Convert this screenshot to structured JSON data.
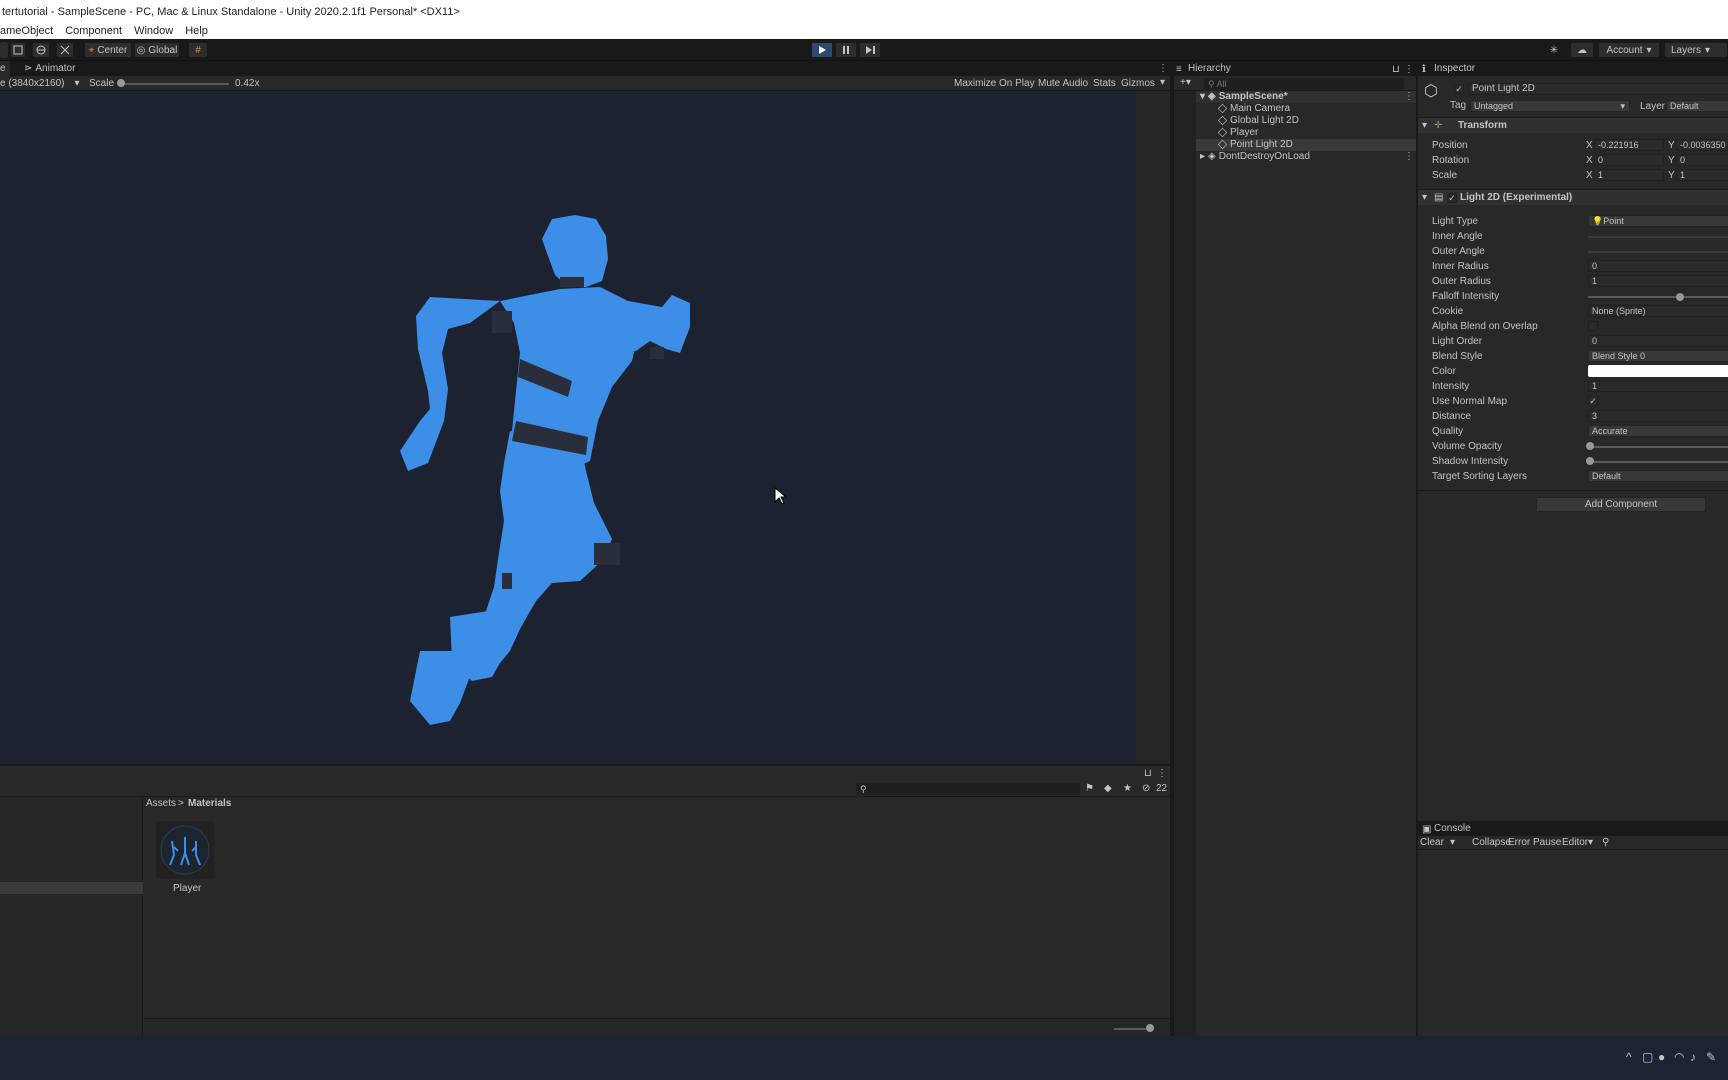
{
  "window": {
    "title": "tertutorial - SampleScene - PC, Mac & Linux Standalone - Unity 2020.2.1f1 Personal* <DX11>"
  },
  "menu": {
    "items": [
      "ameObject",
      "Component",
      "Window",
      "Help"
    ]
  },
  "toolbar": {
    "center_label": "Center",
    "global_label": "Global",
    "play_icon": "play-icon",
    "pause_icon": "pause-icon",
    "step_icon": "step-icon",
    "account_label": "Account",
    "layers_label": "Layers"
  },
  "game": {
    "tab_partial": "e",
    "animator_tab": "Animator",
    "resolution": "e (3840x2160)",
    "scale_label": "Scale",
    "scale_value": "0.42x",
    "scale_level": 0.0,
    "maximize_label": "Maximize On Play",
    "mute_label": "Mute Audio",
    "stats_label": "Stats",
    "gizmos_label": "Gizmos"
  },
  "hierarchy": {
    "title": "Hierarchy",
    "search_placeholder": "All",
    "scene": "SampleScene*",
    "items": [
      "Main Camera",
      "Global Light 2D",
      "Player",
      "Point Light 2D"
    ],
    "dontdestroy": "DontDestroyOnLoad"
  },
  "inspector": {
    "title": "Inspector",
    "object_name": "Point Light 2D",
    "tag_label": "Tag",
    "tag_value": "Untagged",
    "layer_label": "Layer",
    "layer_value": "Default",
    "transform": {
      "title": "Transform",
      "position_label": "Position",
      "position_x": "-0.221916",
      "position_y": "-0.0036350",
      "rotation_label": "Rotation",
      "rotation_x": "0",
      "rotation_y": "0",
      "scale_label": "Scale",
      "scale_x": "1",
      "scale_y": "1",
      "x": "X",
      "y": "Y"
    },
    "light": {
      "title": "Light 2D (Experimental)",
      "rows": {
        "light_type": "Light Type",
        "inner_angle": "Inner Angle",
        "outer_angle": "Outer Angle",
        "inner_radius": "Inner Radius",
        "outer_radius": "Outer Radius",
        "falloff": "Falloff Intensity",
        "cookie": "Cookie",
        "alpha_blend": "Alpha Blend on Overlap",
        "light_order": "Light Order",
        "blend_style": "Blend Style",
        "color": "Color",
        "intensity": "Intensity",
        "normal_map": "Use Normal Map",
        "distance": "Distance",
        "quality": "Quality",
        "volume_opacity": "Volume Opacity",
        "shadow_intensity": "Shadow Intensity",
        "target_layers": "Target Sorting Layers"
      },
      "values": {
        "light_type": "Point",
        "inner_radius": "0",
        "outer_radius": "1",
        "cookie": "None (Sprite)",
        "light_order": "0",
        "blend_style": "Blend Style 0",
        "intensity": "1",
        "normal_map_check": "✓",
        "distance": "3",
        "quality": "Accurate",
        "target_layers": "Default"
      },
      "falloff_level": 0.65,
      "volume_level": 0.0,
      "shadow_level": 0.0,
      "color_hex": "#ffffff"
    },
    "add_component": "Add Component"
  },
  "console": {
    "title": "Console",
    "clear": "Clear",
    "collapse": "Collapse",
    "error_pause": "Error Pause",
    "editor": "Editor"
  },
  "project": {
    "breadcrumb_root": "Assets",
    "breadcrumb_sep": ">",
    "breadcrumb_current": "Materials",
    "asset_name": "Player",
    "hidden_count": "22"
  }
}
